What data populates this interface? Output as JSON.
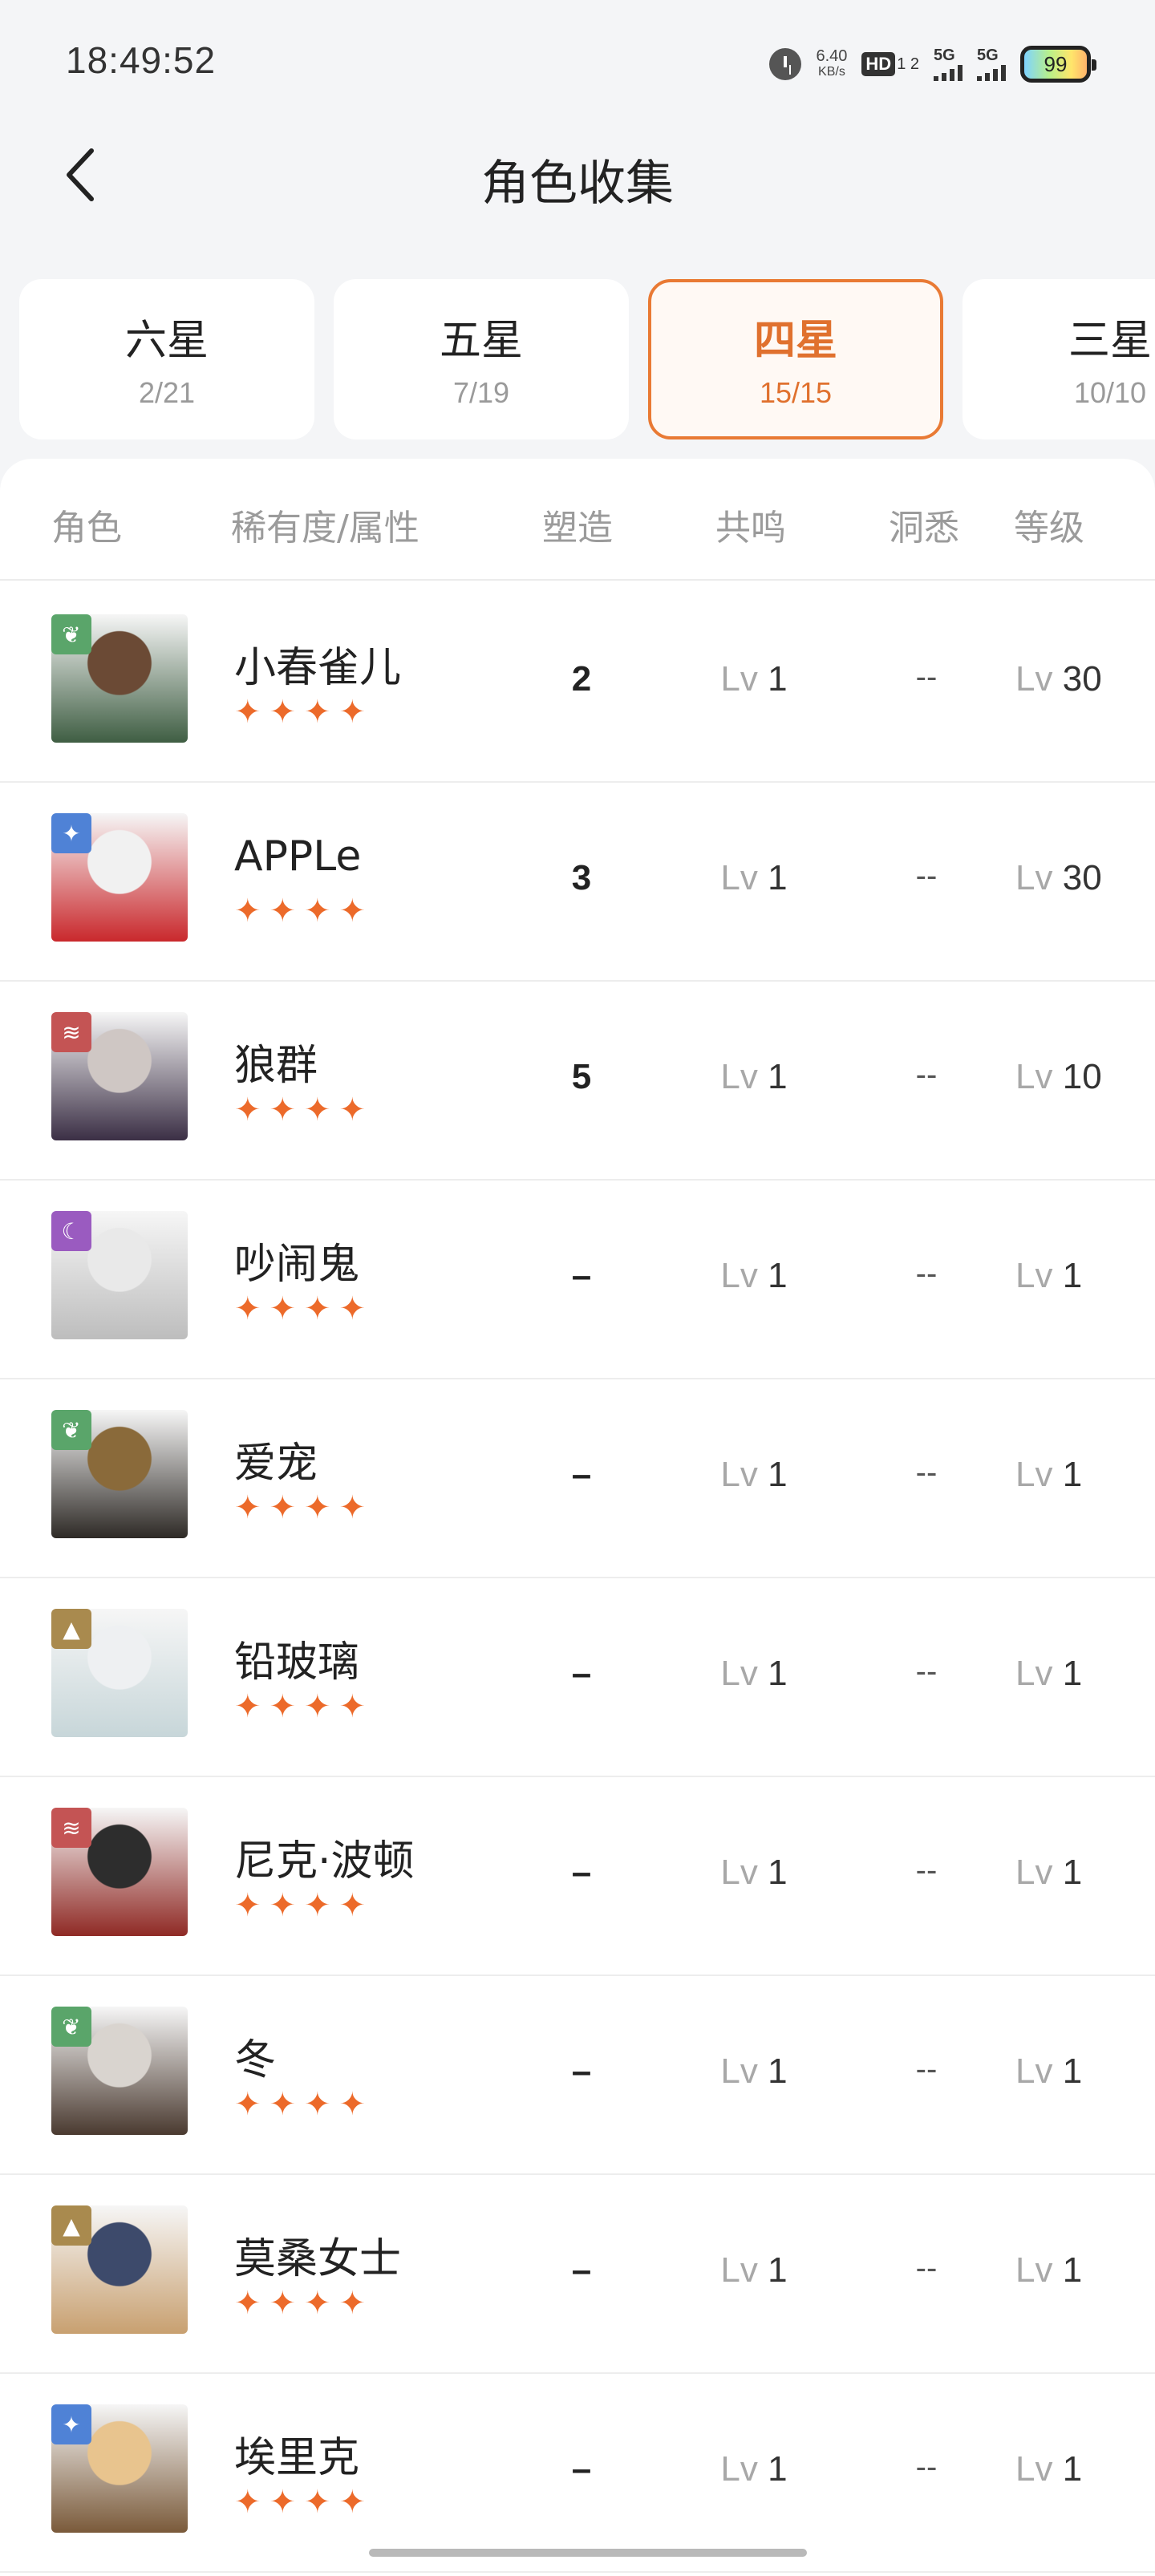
{
  "status": {
    "time": "18:49:52",
    "speed_value": "6.40",
    "speed_unit": "KB/s",
    "hd_label": "HD",
    "hd_sub": "1 2",
    "signal1": "5G",
    "signal2": "5G",
    "battery": "99"
  },
  "header": {
    "title": "角色收集"
  },
  "tabs": [
    {
      "label": "六星",
      "count": "2/21"
    },
    {
      "label": "五星",
      "count": "7/19"
    },
    {
      "label": "四星",
      "count": "15/15"
    },
    {
      "label": "三星",
      "count": "10/10"
    }
  ],
  "columns": {
    "role": "角色",
    "rarity": "稀有度/属性",
    "shape": "塑造",
    "resonance": "共鸣",
    "insight": "洞悉",
    "level": "等级"
  },
  "level_prefix": "Lv",
  "star_glyph": "✦",
  "rows": [
    {
      "name": "小春雀儿",
      "shape": "2",
      "resonance": "1",
      "insight": "--",
      "level": "30"
    },
    {
      "name": "APPLe",
      "shape": "3",
      "resonance": "1",
      "insight": "--",
      "level": "30"
    },
    {
      "name": "狼群",
      "shape": "5",
      "resonance": "1",
      "insight": "--",
      "level": "10"
    },
    {
      "name": "吵闹鬼",
      "shape": "–",
      "resonance": "1",
      "insight": "--",
      "level": "1"
    },
    {
      "name": "爱宠",
      "shape": "–",
      "resonance": "1",
      "insight": "--",
      "level": "1"
    },
    {
      "name": "铅玻璃",
      "shape": "–",
      "resonance": "1",
      "insight": "--",
      "level": "1"
    },
    {
      "name": "尼克·波顿",
      "shape": "–",
      "resonance": "1",
      "insight": "--",
      "level": "1"
    },
    {
      "name": "冬",
      "shape": "–",
      "resonance": "1",
      "insight": "--",
      "level": "1"
    },
    {
      "name": "莫桑女士",
      "shape": "–",
      "resonance": "1",
      "insight": "--",
      "level": "1"
    },
    {
      "name": "埃里克",
      "shape": "–",
      "resonance": "1",
      "insight": "--",
      "level": "1"
    }
  ],
  "attributes": [
    "leaf-icon",
    "star-icon",
    "claw-icon",
    "moon-icon",
    "leaf-icon",
    "mountain-icon",
    "claw-icon",
    "leaf-icon",
    "mountain-icon",
    "star-icon"
  ],
  "attribute_colors": {
    "leaf-icon": "#5aa56a",
    "star-icon": "#4f82d6",
    "claw-icon": "#c45454",
    "moon-icon": "#9a5bc0",
    "mountain-icon": "#a98a4e"
  },
  "accent_color": "#e97a34"
}
